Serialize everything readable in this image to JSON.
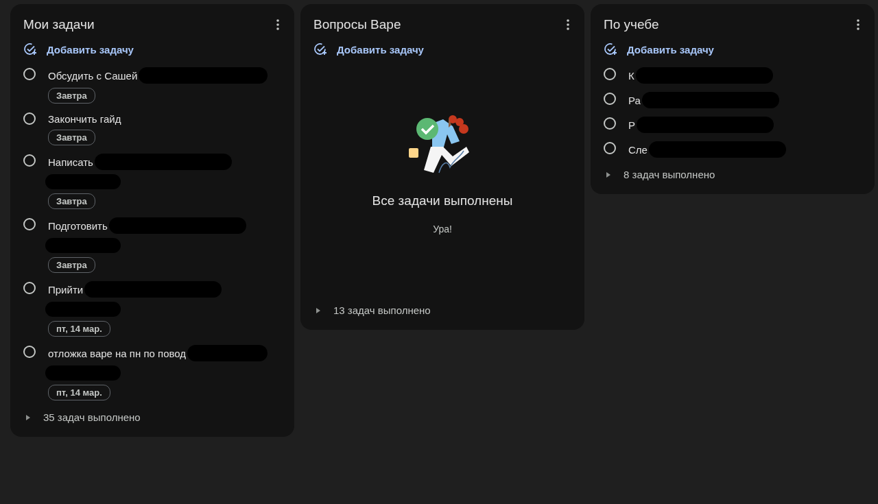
{
  "lists": [
    {
      "title": "Мои задачи",
      "add_label": "Добавить задачу",
      "tasks": [
        {
          "title": "Обсудить с Сашей",
          "checked": false,
          "redacted": true,
          "wrapped": false,
          "date": "Завтра"
        },
        {
          "title": "Закончить гайд",
          "checked": false,
          "redacted": false,
          "wrapped": false,
          "date": "Завтра"
        },
        {
          "title": "Написать",
          "checked": false,
          "redacted": true,
          "wrapped": true,
          "date": "Завтра"
        },
        {
          "title": "Подготовить",
          "checked": false,
          "redacted": true,
          "wrapped": true,
          "date": "Завтра"
        },
        {
          "title": "Прийти",
          "checked": false,
          "redacted": true,
          "wrapped": true,
          "date": "пт, 14 мар."
        },
        {
          "title": "отложка варе на пн по повод",
          "checked": false,
          "redacted": true,
          "wrapped": true,
          "date": "пт, 14 мар."
        }
      ],
      "completed": "35 задач выполнено"
    },
    {
      "title": "Вопросы Варе",
      "add_label": "Добавить задачу",
      "empty": {
        "heading": "Все задачи выполнены",
        "text": "Ура!"
      },
      "completed": "13 задач выполнено"
    },
    {
      "title": "По учебе",
      "add_label": "Добавить задачу",
      "tasks": [
        {
          "title": "К",
          "checked": false,
          "redacted": true,
          "wrapped": false
        },
        {
          "title": "Ра",
          "checked": false,
          "redacted": true,
          "wrapped": false
        },
        {
          "title": "Р",
          "checked": false,
          "redacted": true,
          "wrapped": false
        },
        {
          "title": "Сле",
          "checked": false,
          "redacted": true,
          "wrapped": false
        }
      ],
      "completed": "8 задач выполнено"
    }
  ]
}
